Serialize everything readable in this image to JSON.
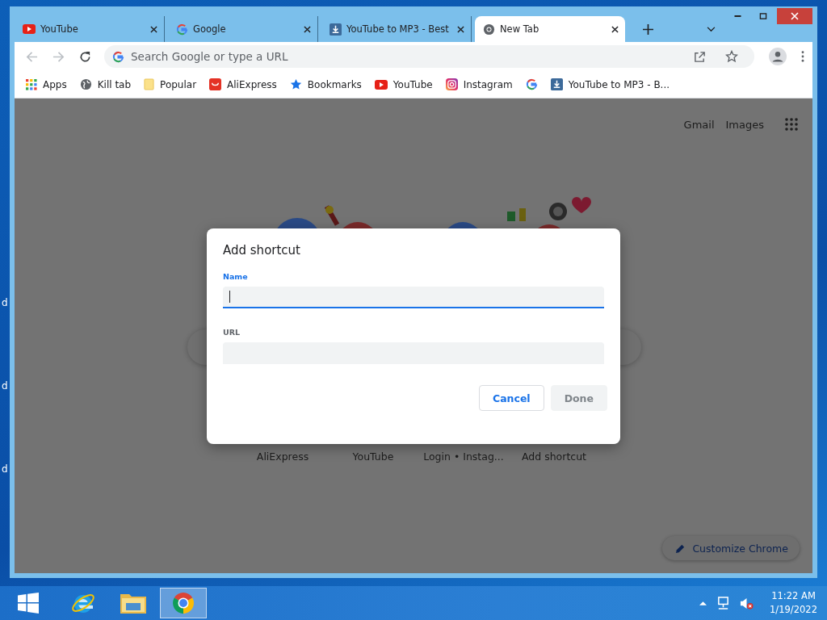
{
  "desktop": {
    "icon_labels": [
      "d",
      "d",
      "d"
    ]
  },
  "browser": {
    "tabs": [
      {
        "title": "YouTube",
        "kind": "youtube",
        "selected": false
      },
      {
        "title": "Google",
        "kind": "google",
        "selected": false
      },
      {
        "title": "YouTube to MP3 - Best",
        "kind": "download",
        "selected": false
      },
      {
        "title": "New Tab",
        "kind": "chrome",
        "selected": true
      }
    ],
    "omnibox": {
      "placeholder": "Search Google or type a URL"
    },
    "bookmarks": [
      {
        "label": "Apps",
        "kind": "apps"
      },
      {
        "label": "Kill tab",
        "kind": "globe"
      },
      {
        "label": "Popular",
        "kind": "folder"
      },
      {
        "label": "AliExpress",
        "kind": "aliexpress"
      },
      {
        "label": "Bookmarks",
        "kind": "star"
      },
      {
        "label": "YouTube",
        "kind": "youtube"
      },
      {
        "label": "Instagram",
        "kind": "instagram"
      },
      {
        "kind": "google"
      },
      {
        "label": "YouTube to MP3 - B...",
        "kind": "download"
      }
    ]
  },
  "page": {
    "header_links": [
      "Gmail",
      "Images"
    ],
    "shortcuts": [
      "AliExpress",
      "YouTube",
      "Login • Instag...",
      "Add shortcut"
    ],
    "customize_button": "Customize Chrome"
  },
  "dialog": {
    "title": "Add shortcut",
    "fields": [
      {
        "label": "Name",
        "focused": true
      },
      {
        "label": "URL",
        "focused": false
      }
    ],
    "buttons": [
      {
        "label": "Cancel",
        "disabled": false
      },
      {
        "label": "Done",
        "disabled": true
      }
    ]
  },
  "taskbar": {
    "apps": [
      {
        "kind": "ie",
        "selected": false
      },
      {
        "kind": "explorer",
        "selected": false
      },
      {
        "kind": "chrome",
        "selected": true
      }
    ],
    "clock": {
      "time": "11:22 AM",
      "date": "1/19/2022"
    }
  }
}
